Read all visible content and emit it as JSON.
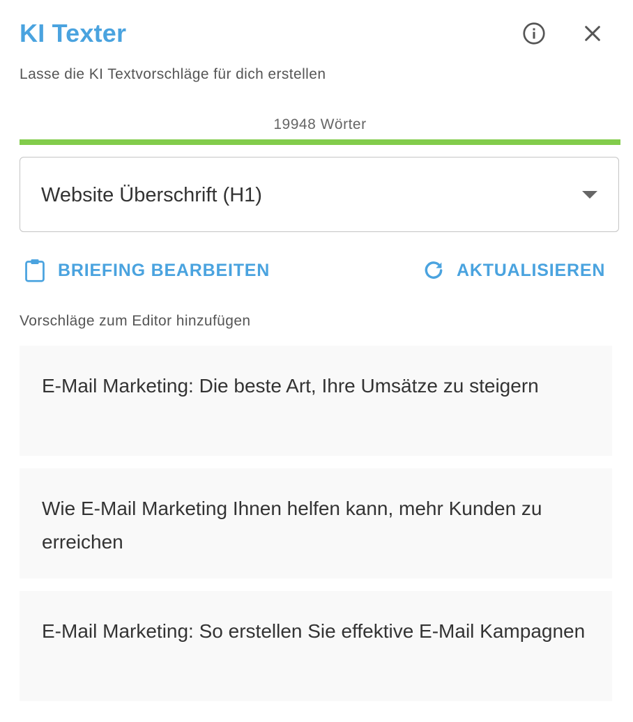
{
  "header": {
    "title": "KI Texter",
    "subtitle": "Lasse die KI Textvorschläge für dich erstellen",
    "info_icon": "info-icon",
    "close_icon": "close-icon"
  },
  "usage": {
    "word_count_label": "19948 Wörter",
    "progress_percent": 100,
    "progress_color": "#82cc4b"
  },
  "select": {
    "value": "Website Überschrift (H1)",
    "icon": "chevron-down-icon"
  },
  "actions": {
    "briefing_label": "BRIEFING BEARBEITEN",
    "briefing_icon": "clipboard-icon",
    "refresh_label": "AKTUALISIEREN",
    "refresh_icon": "refresh-icon"
  },
  "suggestions": {
    "section_label": "Vorschläge zum Editor hinzufügen",
    "items": [
      "E-Mail Marketing: Die beste Art, Ihre Umsätze zu steigern",
      "Wie E-Mail Marketing Ihnen helfen kann, mehr Kunden zu erreichen",
      "E-Mail Marketing: So erstellen Sie effektive E-Mail Kampagnen"
    ]
  },
  "colors": {
    "accent": "#4aa3df",
    "progress": "#82cc4b",
    "card_background": "#f9f9f9"
  }
}
